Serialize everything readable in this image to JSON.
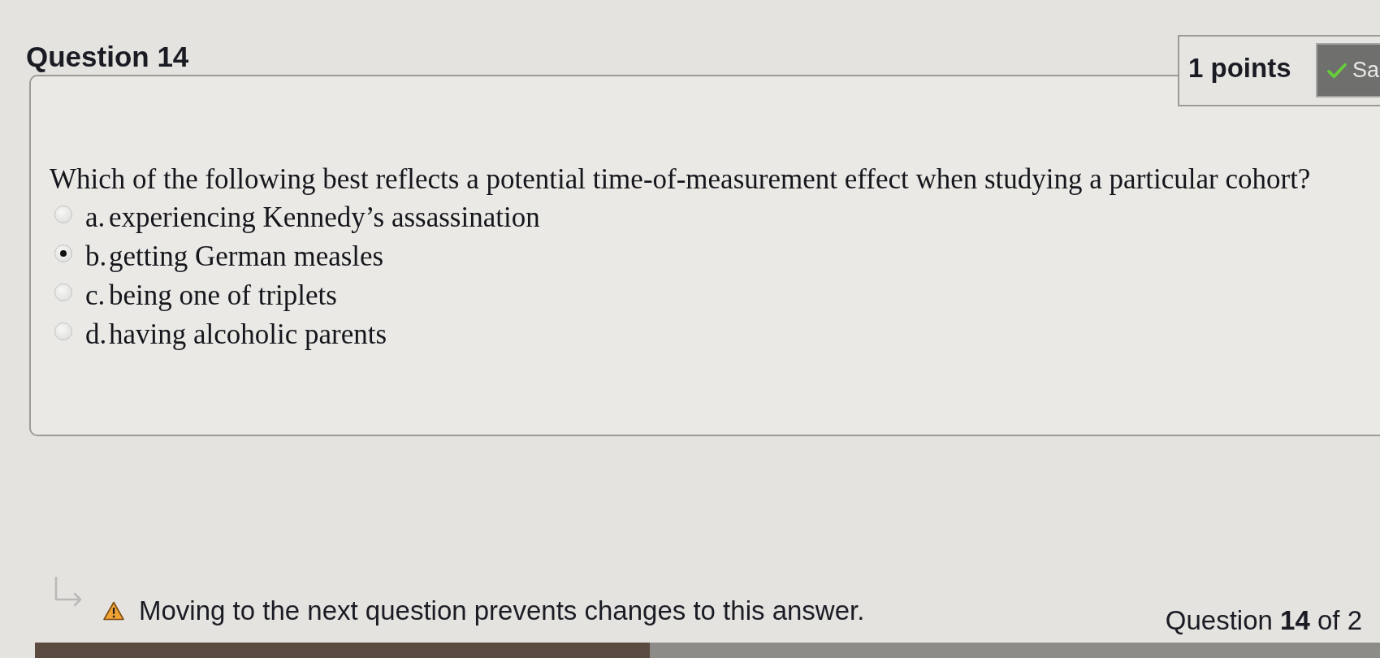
{
  "question": {
    "title": "Question 14",
    "points": "1 points",
    "save_button": "Sa",
    "prompt": "Which of the following best reflects a potential time-of-measurement effect when studying a particular cohort?",
    "options": [
      {
        "letter": "a.",
        "text": "experiencing Kennedy’s assassination",
        "selected": false
      },
      {
        "letter": "b.",
        "text": "getting German measles",
        "selected": true
      },
      {
        "letter": "c.",
        "text": "being one of triplets",
        "selected": false
      },
      {
        "letter": "d.",
        "text": "having alcoholic parents",
        "selected": false
      }
    ]
  },
  "footer": {
    "warning": "Moving to the next question prevents changes to this answer.",
    "progress": "Question **14** of 2"
  }
}
